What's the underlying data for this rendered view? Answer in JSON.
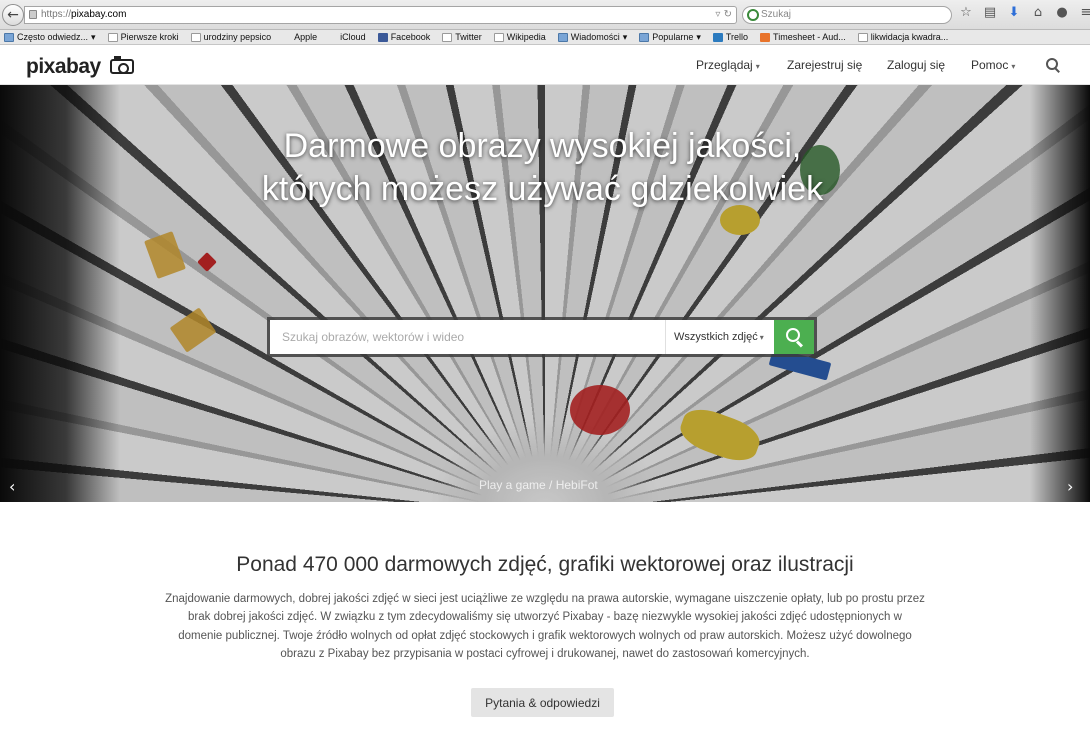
{
  "browser": {
    "url_scheme": "https://",
    "url_host": "pixabay.com",
    "search_placeholder": "Szukaj"
  },
  "bookmarks": [
    {
      "label": "Często odwiedz...",
      "icon": "folder-icon",
      "dropdown": true
    },
    {
      "label": "Pierwsze kroki",
      "icon": "page-icon"
    },
    {
      "label": "urodziny pepsico",
      "icon": "page-icon"
    },
    {
      "label": "Apple",
      "icon": "apple-icon"
    },
    {
      "label": "iCloud",
      "icon": "apple-icon"
    },
    {
      "label": "Facebook",
      "icon": "facebook-icon"
    },
    {
      "label": "Twitter",
      "icon": "page-icon"
    },
    {
      "label": "Wikipedia",
      "icon": "page-icon"
    },
    {
      "label": "Wiadomości",
      "icon": "folder-icon",
      "dropdown": true
    },
    {
      "label": "Popularne",
      "icon": "folder-icon",
      "dropdown": true
    },
    {
      "label": "Trello",
      "icon": "trello-icon"
    },
    {
      "label": "Timesheet - Aud...",
      "icon": "timesheet-icon"
    },
    {
      "label": "likwidacja kwadra...",
      "icon": "page-icon"
    }
  ],
  "site": {
    "logo": "pixabay",
    "nav": {
      "browse": "Przeglądaj",
      "register": "Zarejestruj się",
      "login": "Zaloguj się",
      "help": "Pomoc"
    }
  },
  "hero": {
    "title": "Darmowe obrazy wysokiej jakości, których możesz używać gdziekolwiek",
    "search_placeholder": "Szukaj obrazów, wektorów i wideo",
    "search_type": "Wszystkich zdjęć",
    "caption": "Play a game / HebiFot",
    "prev": "‹",
    "next": "›"
  },
  "content": {
    "title": "Ponad 470 000 darmowych zdjęć, grafiki wektorowej oraz ilustracji",
    "description": "Znajdowanie darmowych, dobrej jakości zdjęć w sieci jest uciążliwe ze względu na prawa autorskie, wymagane uiszczenie opłaty, lub po prostu przez brak dobrej jakości zdjęć. W związku z tym zdecydowaliśmy się utworzyć Pixabay - bazę niezwykle wysokiej jakości zdjęć udostępnionych w domenie publicznej. Twoje źródło wolnych od opłat zdjęć stockowych i grafik wektorowych wolnych od praw autorskich. Możesz użyć dowolnego obrazu z Pixabay bez przypisania w postaci cyfrowej i drukowanej, nawet do zastosowań komercyjnych.",
    "faq_button": "Pytania & odpowiedzi"
  },
  "colors": {
    "accent_green": "#4caf50",
    "firefox_download_blue": "#2e6fd8"
  }
}
